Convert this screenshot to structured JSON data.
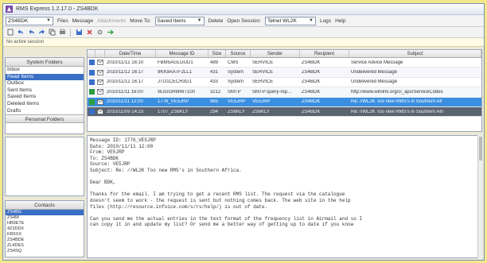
{
  "window": {
    "title": "RMS Express 1.2.17.0 - ZS4BDK"
  },
  "menubar": {
    "callsign": "ZS4BDK",
    "items": [
      "Files",
      "Message",
      "Attachments",
      "Move To:",
      "Saved Items",
      "Delete",
      "Open Session:",
      "Telnet WL2K",
      "Logs",
      "Help"
    ]
  },
  "notice": "No active session",
  "folders": {
    "header": "System Folders",
    "items": [
      "Inbox",
      "Read Items",
      "Outbox",
      "Sent Items",
      "Saved Items",
      "Deleted Items",
      "Drafts"
    ],
    "personal_header": "Personal Folders"
  },
  "contacts": {
    "header": "Contacts",
    "items": [
      "ZS4BG",
      "ZS4M",
      "HB9ETE",
      "4Z3DDX",
      "KR6XX",
      "ZS4BDE",
      "ZL4DES",
      "ZS4SQ"
    ]
  },
  "table": {
    "columns": [
      "Date/Time",
      "Message ID",
      "Size",
      "Source",
      "Sender",
      "Recipient",
      "Subject"
    ],
    "rows": [
      {
        "date": "2010/11/12 16:10",
        "id": "FBM5AGLGUD1",
        "size": "489",
        "source": "CMS",
        "sender": "SERVICE",
        "recipient": "ZS4BDK",
        "subject": "Service Advice Message",
        "flag_color": "#3a6fc6",
        "style": "normal"
      },
      {
        "date": "2010/11/12 16:17",
        "id": "9KK9AATF2LL1",
        "size": "431",
        "source": "System",
        "sender": "SERVICE",
        "recipient": "ZS4BDK",
        "subject": "Undelivered Message",
        "flag_color": "#3a6fc6",
        "style": "alt"
      },
      {
        "date": "2010/11/12 16:17",
        "id": "JTO1CECH3G1",
        "size": "433",
        "source": "System",
        "sender": "SERVICE",
        "recipient": "ZS4BDK",
        "subject": "Undelivered Message",
        "flag_color": "#3a6fc6",
        "style": "normal"
      },
      {
        "date": "2010/11/11 16:00",
        "id": "WJGGR6R6T100",
        "size": "3212",
        "source": "SMTP",
        "sender": "SMTP:query-rep...",
        "recipient": "ZS4BDK",
        "subject": "http://www.winlink.org/cl_aps/ServiceCodes",
        "flag_color": "#2e9e3e",
        "style": "alt"
      },
      {
        "date": "2010/11/11 12:00",
        "id": "1776_VE5JRP",
        "size": "965",
        "source": "VE5JRP",
        "sender": "VE5JRP",
        "recipient": "ZS4BDK",
        "subject": "Re: //WL2K Too new RMS's in Southern Afr",
        "flag_color": "#2e9e3e",
        "style": "selected"
      },
      {
        "date": "2010/11/09 14:23",
        "id": "1707_ZS6KLY",
        "size": "294",
        "source": "ZS6KLY",
        "sender": "ZS6KLY",
        "recipient": "ZS4BDK",
        "subject": "Re: //WL2K Too new RMS's in Southern Afri",
        "flag_color": "#3a6fc6",
        "style": "dark"
      }
    ]
  },
  "message": {
    "header_lines": [
      "Message ID: 1776_VE5JRP",
      "Date: 2010/11/11 12:00",
      "From: VE5JRP",
      "To: ZS4BDK",
      "Source: VE5JRP",
      "Subject: Re: //WL2K Too new RMS's in Southern Africa."
    ],
    "greeting": "Dear BDK,",
    "body_lines": [
      "Thanks for the email. I am trying to get a recent RMS list. The request via the catalogue",
      "doesn't seem to work - the request is sent but nothing comes back. The web site in the help",
      "files (http://resource.infoice.com/s/rs/help/) is out of date."
    ],
    "body2_lines": [
      "Can you send me the actual entries in the text format of the frequency list in Airmail and so I",
      "can copy it in and update my list? Or send me a better way of getting up to date if you know"
    ]
  }
}
